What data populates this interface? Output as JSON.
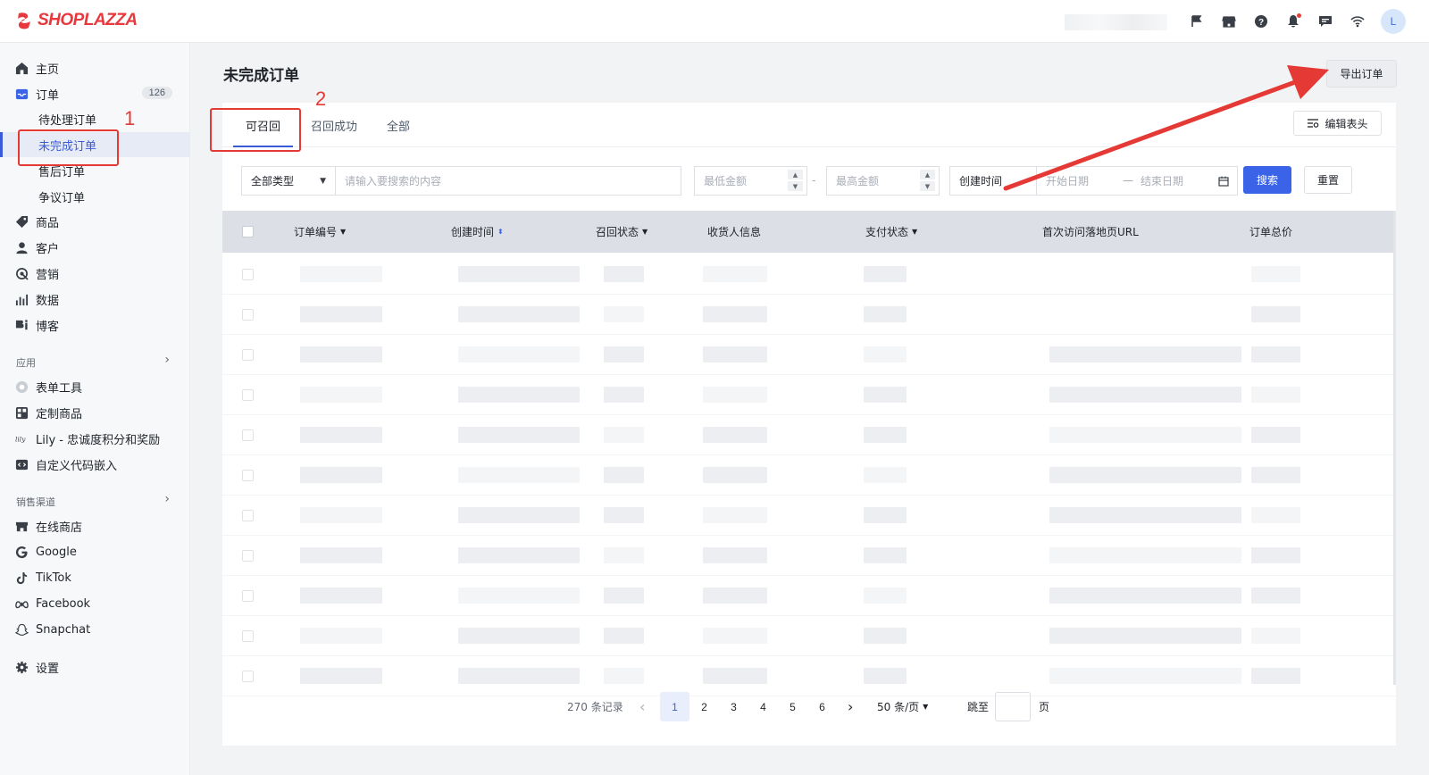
{
  "brand": {
    "name": "SHOPLAZZA",
    "color": "#e8383d"
  },
  "topbar": {
    "icons": [
      "flag-icon",
      "store-icon",
      "help-icon",
      "bell-icon",
      "message-icon",
      "wifi-icon"
    ],
    "avatar_letter": "L"
  },
  "sidebar": {
    "items": [
      {
        "label": "主页",
        "icon": "home-icon"
      },
      {
        "label": "订单",
        "icon": "inbox-icon",
        "badge": "126"
      },
      {
        "label": "商品",
        "icon": "tag-icon"
      },
      {
        "label": "客户",
        "icon": "user-icon"
      },
      {
        "label": "营销",
        "icon": "marketing-icon"
      },
      {
        "label": "数据",
        "icon": "chart-icon"
      },
      {
        "label": "博客",
        "icon": "blog-icon"
      }
    ],
    "order_subitems": [
      {
        "label": "待处理订单"
      },
      {
        "label": "未完成订单",
        "active": true
      },
      {
        "label": "售后订单"
      },
      {
        "label": "争议订单"
      }
    ],
    "apps_label": "应用",
    "apps": [
      {
        "label": "表单工具",
        "icon": "form-icon"
      },
      {
        "label": "定制商品",
        "icon": "custom-product-icon"
      },
      {
        "label": "Lily - 忠诚度积分和奖励",
        "icon": "lily-icon"
      },
      {
        "label": "自定义代码嵌入",
        "icon": "code-icon"
      }
    ],
    "channels_label": "销售渠道",
    "channels": [
      {
        "label": "在线商店",
        "icon": "store-icon"
      },
      {
        "label": "Google",
        "icon": "google-icon"
      },
      {
        "label": "TikTok",
        "icon": "tiktok-icon"
      },
      {
        "label": "Facebook",
        "icon": "meta-icon"
      },
      {
        "label": "Snapchat",
        "icon": "snapchat-icon"
      }
    ],
    "settings_label": "设置"
  },
  "page": {
    "title": "未完成订单",
    "export_label": "导出订单",
    "edit_header_label": "编辑表头"
  },
  "tabs": [
    {
      "label": "可召回",
      "active": true
    },
    {
      "label": "召回成功"
    },
    {
      "label": "全部"
    }
  ],
  "filters": {
    "type_value": "全部类型",
    "search_placeholder": "请输入要搜索的内容",
    "min_amount_placeholder": "最低金额",
    "amount_separator": "-",
    "max_amount_placeholder": "最高金额",
    "time_field": "创建时间",
    "start_date_placeholder": "开始日期",
    "date_separator": "一",
    "end_date_placeholder": "结束日期",
    "search_button": "搜索",
    "reset_button": "重置"
  },
  "table": {
    "columns": [
      "订单编号",
      "创建时间",
      "召回状态",
      "收货人信息",
      "支付状态",
      "首次访问落地页URL",
      "订单总价"
    ]
  },
  "pagination": {
    "total_text": "270 条记录",
    "pages": [
      "1",
      "2",
      "3",
      "4",
      "5",
      "6"
    ],
    "current": "1",
    "page_size": "50 条/页",
    "jump_label": "跳至",
    "page_suffix": "页"
  },
  "annotations": {
    "marker_1": "1",
    "marker_2": "2",
    "color": "#e53935"
  }
}
